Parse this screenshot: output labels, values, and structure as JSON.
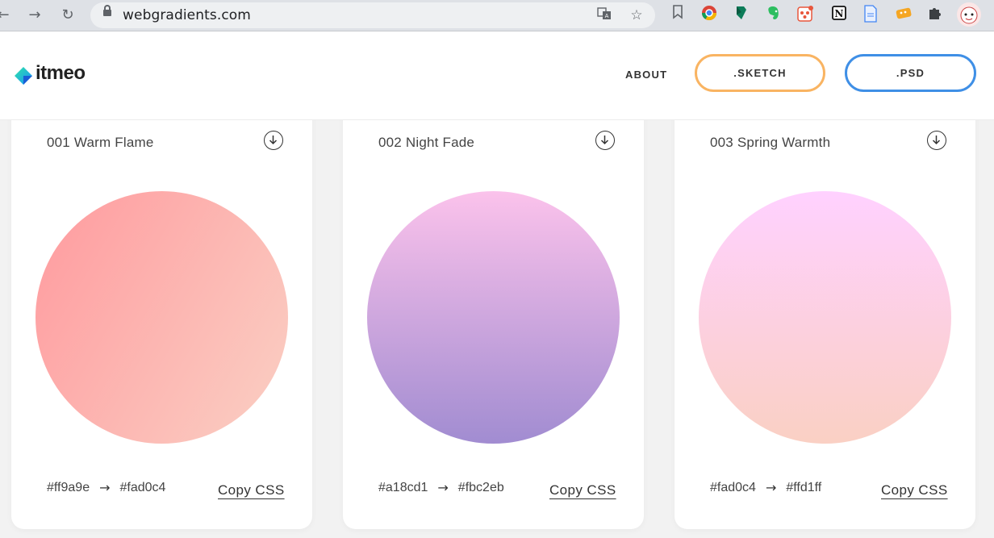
{
  "browser": {
    "url": "webgradients.com",
    "icons": [
      "back-icon",
      "forward-icon",
      "reload-icon",
      "lock-icon",
      "translate-icon",
      "star-icon",
      "bookmark-icon",
      "chrome-ext-icon",
      "pin-ext-icon",
      "evernote-icon",
      "people-ext-icon",
      "notion-icon",
      "doc-ext-icon",
      "keyboard-ext-icon",
      "puzzle-icon",
      "avatar"
    ]
  },
  "header": {
    "logo": "itmeo",
    "nav_about": "ABOUT",
    "btn_sketch": ".SKETCH",
    "btn_psd": ".PSD",
    "colors": {
      "sketch_border": "#f9b462",
      "psd_border": "#3f8fe6"
    }
  },
  "gradients": [
    {
      "title": "001 Warm Flame",
      "from": "#ff9a9e",
      "arrow": "→",
      "to": "#fad0c4",
      "copy": "Copy CSS"
    },
    {
      "title": "002 Night Fade",
      "from": "#a18cd1",
      "arrow": "→",
      "to": "#fbc2eb",
      "copy": "Copy CSS"
    },
    {
      "title": "003 Spring Warmth",
      "from": "#fad0c4",
      "arrow": "→",
      "to": "#ffd1ff",
      "copy": "Copy CSS"
    }
  ]
}
